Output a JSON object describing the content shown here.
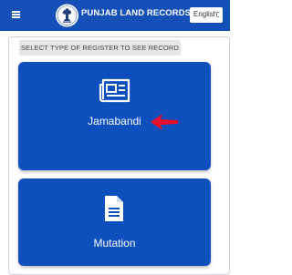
{
  "header": {
    "title": "PUNJAB LAND RECORDS",
    "menu_icon": "hamburger-menu-icon",
    "emblem_icon": "state-emblem-icon",
    "language": {
      "selected": "English",
      "icon": "chevron-down-icon"
    }
  },
  "main": {
    "section_label": "SELECT TYPE OF REGISTER TO SEE RECORD",
    "cards": [
      {
        "label": "Jamabandi",
        "icon": "newspaper-icon"
      },
      {
        "label": "Mutation",
        "icon": "document-icon"
      }
    ],
    "annotation_icon": "red-arrow-icon"
  },
  "colors": {
    "header_bg": "#1450b8",
    "card_bg": "#0d4fbd",
    "section_label_bg": "#e6e6e6",
    "annotation": "#e8102e"
  }
}
